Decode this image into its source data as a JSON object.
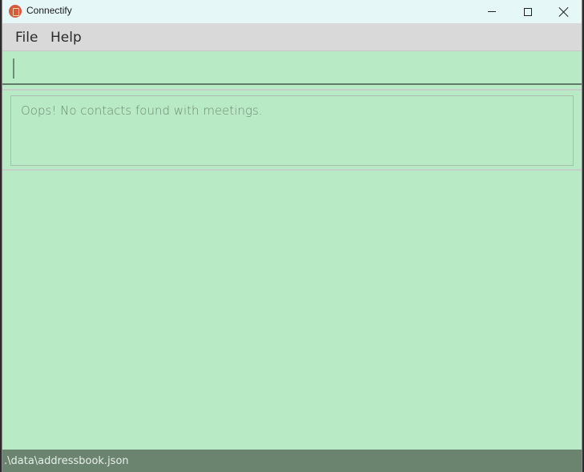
{
  "window": {
    "title": "Connectify",
    "icon": "app-icon"
  },
  "menu": {
    "items": [
      {
        "label": "File"
      },
      {
        "label": "Help"
      }
    ]
  },
  "command": {
    "value": ""
  },
  "result": {
    "message": "Oops! No contacts found with meetings."
  },
  "status": {
    "path": ".\\data\\addressbook.json"
  },
  "colors": {
    "background": "#b9eac6",
    "status_bar": "#6b846f",
    "menubar": "#d9d9d9",
    "titlebar": "#e6f7f8"
  }
}
